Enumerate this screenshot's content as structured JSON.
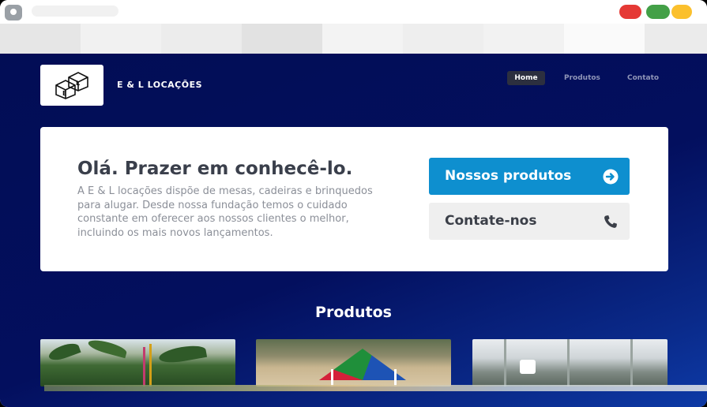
{
  "brand": {
    "name": "E & L LOCAÇÕES",
    "logo_letters": [
      "E",
      "L"
    ]
  },
  "nav": {
    "items": [
      {
        "label": "Home",
        "active": true
      },
      {
        "label": "Produtos",
        "active": false
      },
      {
        "label": "Contato",
        "active": false
      }
    ]
  },
  "hero": {
    "title": "Olá. Prazer em conhecê-lo.",
    "description": "A E & L locações dispõe de mesas, cadeiras e brinquedos para alugar. Desde nossa fundação temos o cuidado constante em oferecer aos nossos clientes o melhor, incluindo os mais novos lançamentos.",
    "primary_button": {
      "label": "Nossos produtos",
      "icon": "arrow-circle-right-icon"
    },
    "secondary_button": {
      "label": "Contate-nos",
      "icon": "phone-icon"
    }
  },
  "products": {
    "title": "Produtos",
    "items": [
      {
        "image": "palm-garden-photo"
      },
      {
        "image": "colorful-tent-photo"
      },
      {
        "image": "event-tent-photo"
      }
    ]
  },
  "colors": {
    "page_bg": "#030f5e",
    "primary_button": "#0e8fcf",
    "secondary_button": "#efefef",
    "nav_active": "#2c2f3f"
  }
}
